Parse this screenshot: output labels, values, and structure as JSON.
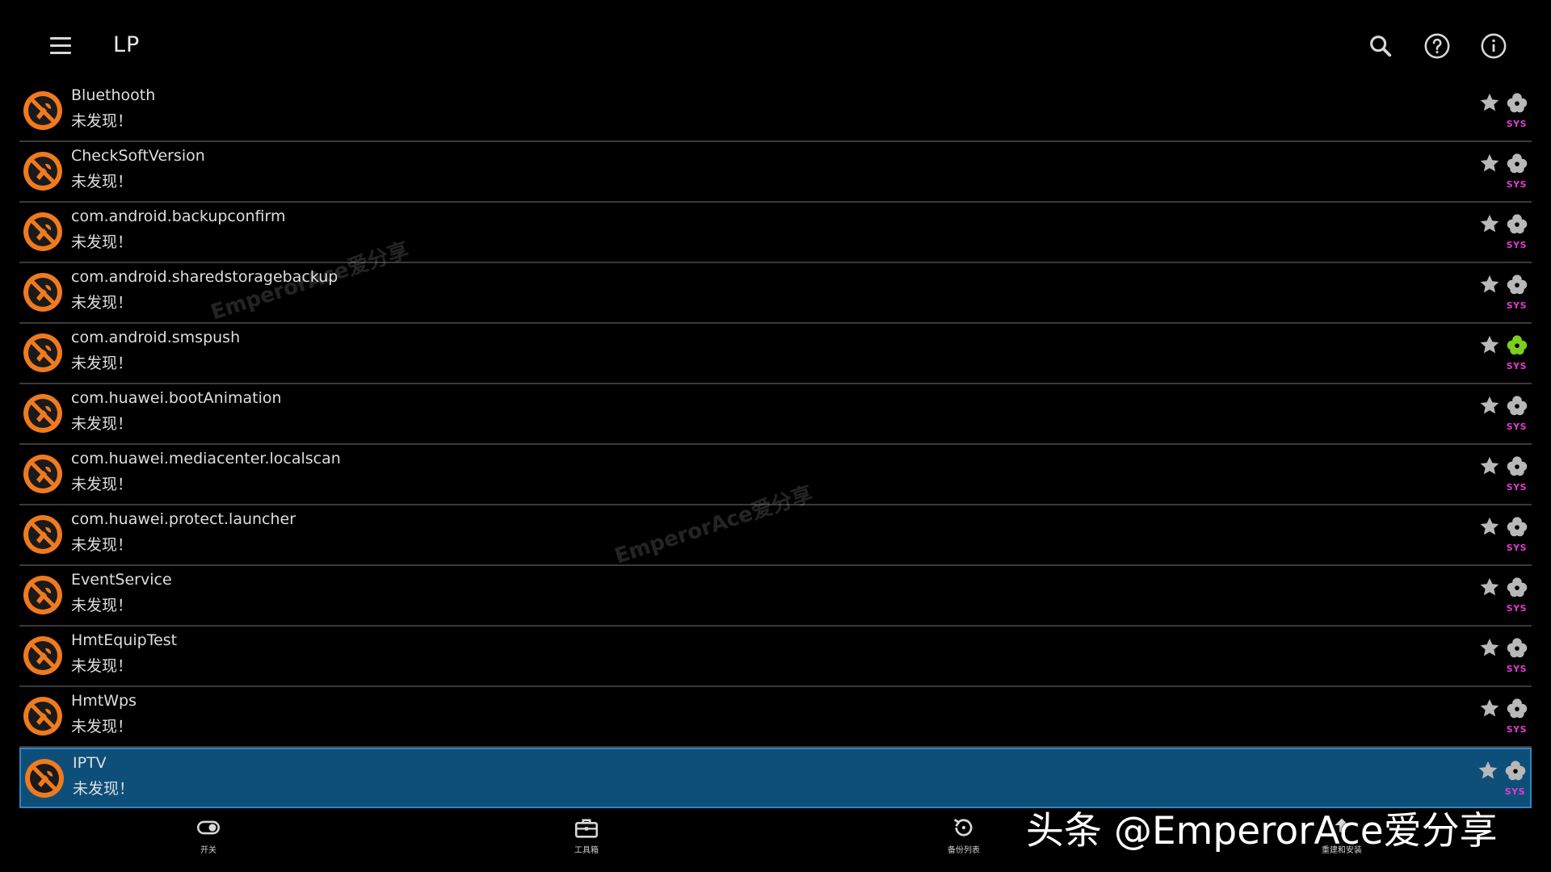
{
  "header": {
    "title": "LP"
  },
  "apps": [
    {
      "name": "Bluethooth",
      "status": "未发现！",
      "badge": "SYS",
      "sys_active": false
    },
    {
      "name": "CheckSoftVersion",
      "status": "未发现！",
      "badge": "SYS",
      "sys_active": false
    },
    {
      "name": "com.android.backupconfirm",
      "status": "未发现！",
      "badge": "SYS",
      "sys_active": false
    },
    {
      "name": "com.android.sharedstoragebackup",
      "status": "未发现！",
      "badge": "SYS",
      "sys_active": false
    },
    {
      "name": "com.android.smspush",
      "status": "未发现！",
      "badge": "SYS",
      "sys_active": true
    },
    {
      "name": "com.huawei.bootAnimation",
      "status": "未发现！",
      "badge": "SYS",
      "sys_active": false
    },
    {
      "name": "com.huawei.mediacenter.localscan",
      "status": "未发现！",
      "badge": "SYS",
      "sys_active": false
    },
    {
      "name": "com.huawei.protect.launcher",
      "status": "未发现！",
      "badge": "SYS",
      "sys_active": false
    },
    {
      "name": "EventService",
      "status": "未发现！",
      "badge": "SYS",
      "sys_active": false
    },
    {
      "name": "HmtEquipTest",
      "status": "未发现！",
      "badge": "SYS",
      "sys_active": false
    },
    {
      "name": "HmtWps",
      "status": "未发现！",
      "badge": "SYS",
      "sys_active": false
    },
    {
      "name": "IPTV",
      "status": "未发现！",
      "badge": "SYS",
      "sys_active": false,
      "selected": true
    }
  ],
  "bottom_nav": [
    {
      "label": "开关",
      "icon": "toggle-icon"
    },
    {
      "label": "工具箱",
      "icon": "toolbox-icon"
    },
    {
      "label": "备份列表",
      "icon": "restore-icon"
    },
    {
      "label": "重建和安装",
      "icon": "rebuild-icon"
    }
  ],
  "watermarks": [
    "EmperorAce爱分享",
    "EmperorAce爱分享"
  ],
  "brand_watermark": "头条 @EmperorAce爱分享",
  "colors": {
    "background": "#000000",
    "selected_row": "#0e4f7a",
    "app_icon_orange": "#f07a1e",
    "sys_badge": "#e23bd0",
    "sys_active_green": "#7ccf1d",
    "icon_gray": "#b8b8b8"
  }
}
